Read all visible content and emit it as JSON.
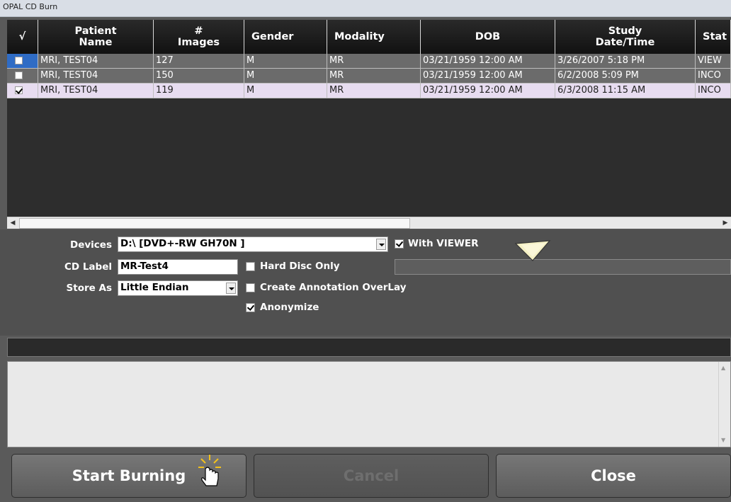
{
  "window": {
    "title": "OPAL CD Burn"
  },
  "grid": {
    "columns": [
      "√",
      "Patient\nName",
      "#\nImages",
      "Gender",
      "Modality",
      "DOB",
      "Study\nDate/Time",
      "Stat"
    ],
    "rows": [
      {
        "checked": false,
        "name": "MRI, TEST04",
        "images": "127",
        "gender": "M",
        "modality": "MR",
        "dob": "03/21/1959 12:00 AM",
        "study": "3/26/2007 5:18 PM",
        "status": "VIEW"
      },
      {
        "checked": false,
        "name": "MRI, TEST04",
        "images": "150",
        "gender": "M",
        "modality": "MR",
        "dob": "03/21/1959 12:00 AM",
        "study": "6/2/2008 5:09 PM",
        "status": "INCO"
      },
      {
        "checked": true,
        "name": "MRI, TEST04",
        "images": "119",
        "gender": "M",
        "modality": "MR",
        "dob": "03/21/1959 12:00 AM",
        "study": "6/3/2008 11:15 AM",
        "status": "INCO"
      }
    ]
  },
  "options": {
    "devices_label": "Devices",
    "devices_value": "D:\\ [DVD+-RW GH70N  ]",
    "cdlabel_label": "CD Label",
    "cdlabel_value": "MR-Test4",
    "storeas_label": "Store As",
    "storeas_value": "Little Endian",
    "with_viewer": {
      "label": "With VIEWER",
      "checked": true
    },
    "hard_disc_only": {
      "label": "Hard Disc Only",
      "checked": false
    },
    "annotation_overlay": {
      "label": "Create Annotation OverLay",
      "checked": false
    },
    "anonymize": {
      "label": "Anonymize",
      "checked": true
    }
  },
  "buttons": {
    "start": "Start Burning",
    "cancel": "Cancel",
    "close": "Close"
  },
  "colors": {
    "selected_row": "#e7dcf0",
    "row": "#6b6b6b",
    "header": "#1d1d1d"
  }
}
